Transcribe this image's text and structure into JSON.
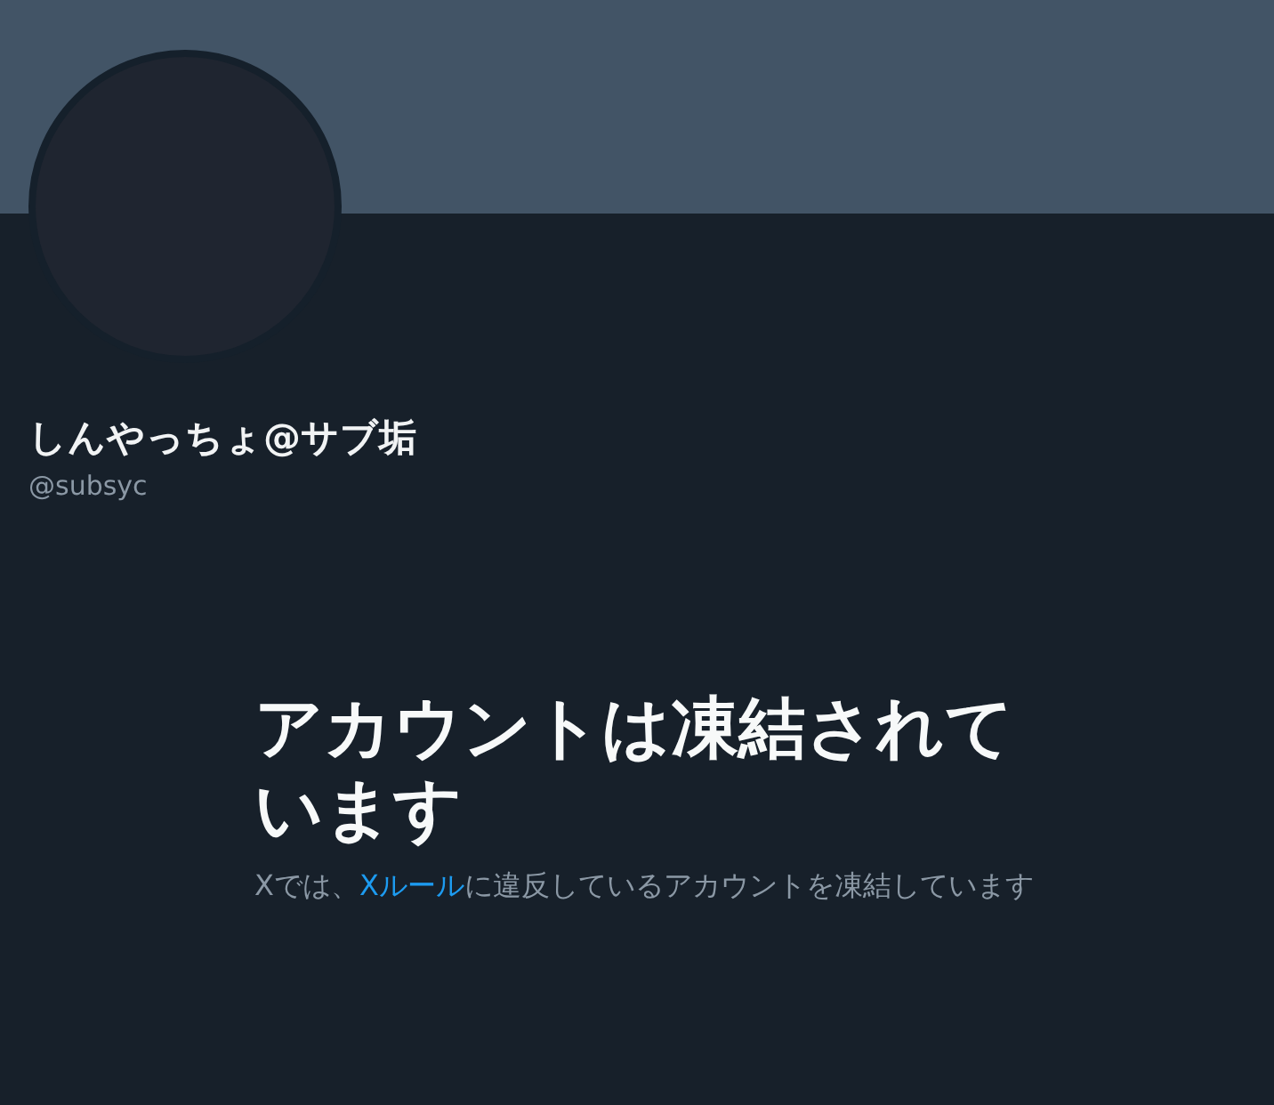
{
  "profile": {
    "name": "しんやっちょ@サブ垢",
    "handle": "@subsyc"
  },
  "notice": {
    "title": "アカウントは凍結されています",
    "description": {
      "before": "Xでは、",
      "link": "Xルール",
      "after": "に違反しているアカウントを凍結しています"
    }
  }
}
